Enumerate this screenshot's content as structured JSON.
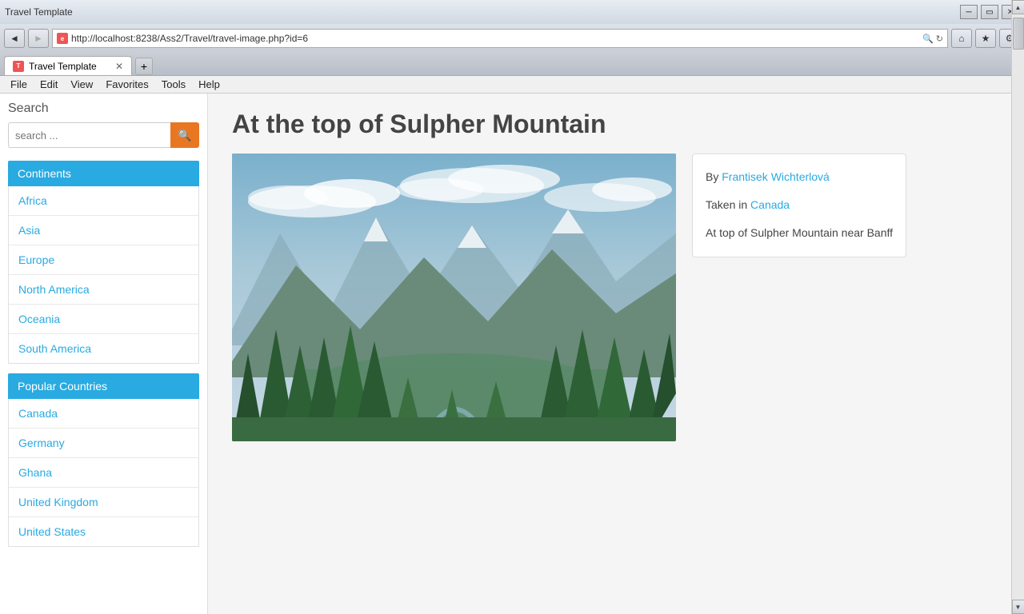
{
  "browser": {
    "address": "http://localhost:8238/Ass2/Travel/travel-image.php?id=6",
    "tab_title": "Travel Template",
    "favicon_label": "T",
    "back_btn": "◄",
    "forward_btn": "►",
    "reload_btn": "↻",
    "close_btn": "✕",
    "minimize_btn": "─",
    "maximize_btn": "▭",
    "search_addr_icon": "🔍",
    "new_tab_btn": "+"
  },
  "menubar": {
    "items": [
      "File",
      "Edit",
      "View",
      "Favorites",
      "Tools",
      "Help"
    ]
  },
  "sidebar": {
    "search_title": "Search",
    "search_placeholder": "search ...",
    "search_btn_icon": "🔍",
    "continents_header": "Continents",
    "continents": [
      {
        "label": "Africa"
      },
      {
        "label": "Asia"
      },
      {
        "label": "Europe"
      },
      {
        "label": "North America"
      },
      {
        "label": "Oceania"
      },
      {
        "label": "South America"
      }
    ],
    "countries_header": "Popular Countries",
    "countries": [
      {
        "label": "Canada"
      },
      {
        "label": "Germany"
      },
      {
        "label": "Ghana"
      },
      {
        "label": "United Kingdom"
      },
      {
        "label": "United States"
      }
    ]
  },
  "main": {
    "page_title": "At the top of Sulpher Mountain",
    "info": {
      "author_prefix": "By ",
      "author": "Frantisek Wichterlová",
      "taken_prefix": "Taken in ",
      "taken_location": "Canada",
      "description": "At top of Sulpher Mountain near Banff"
    }
  }
}
